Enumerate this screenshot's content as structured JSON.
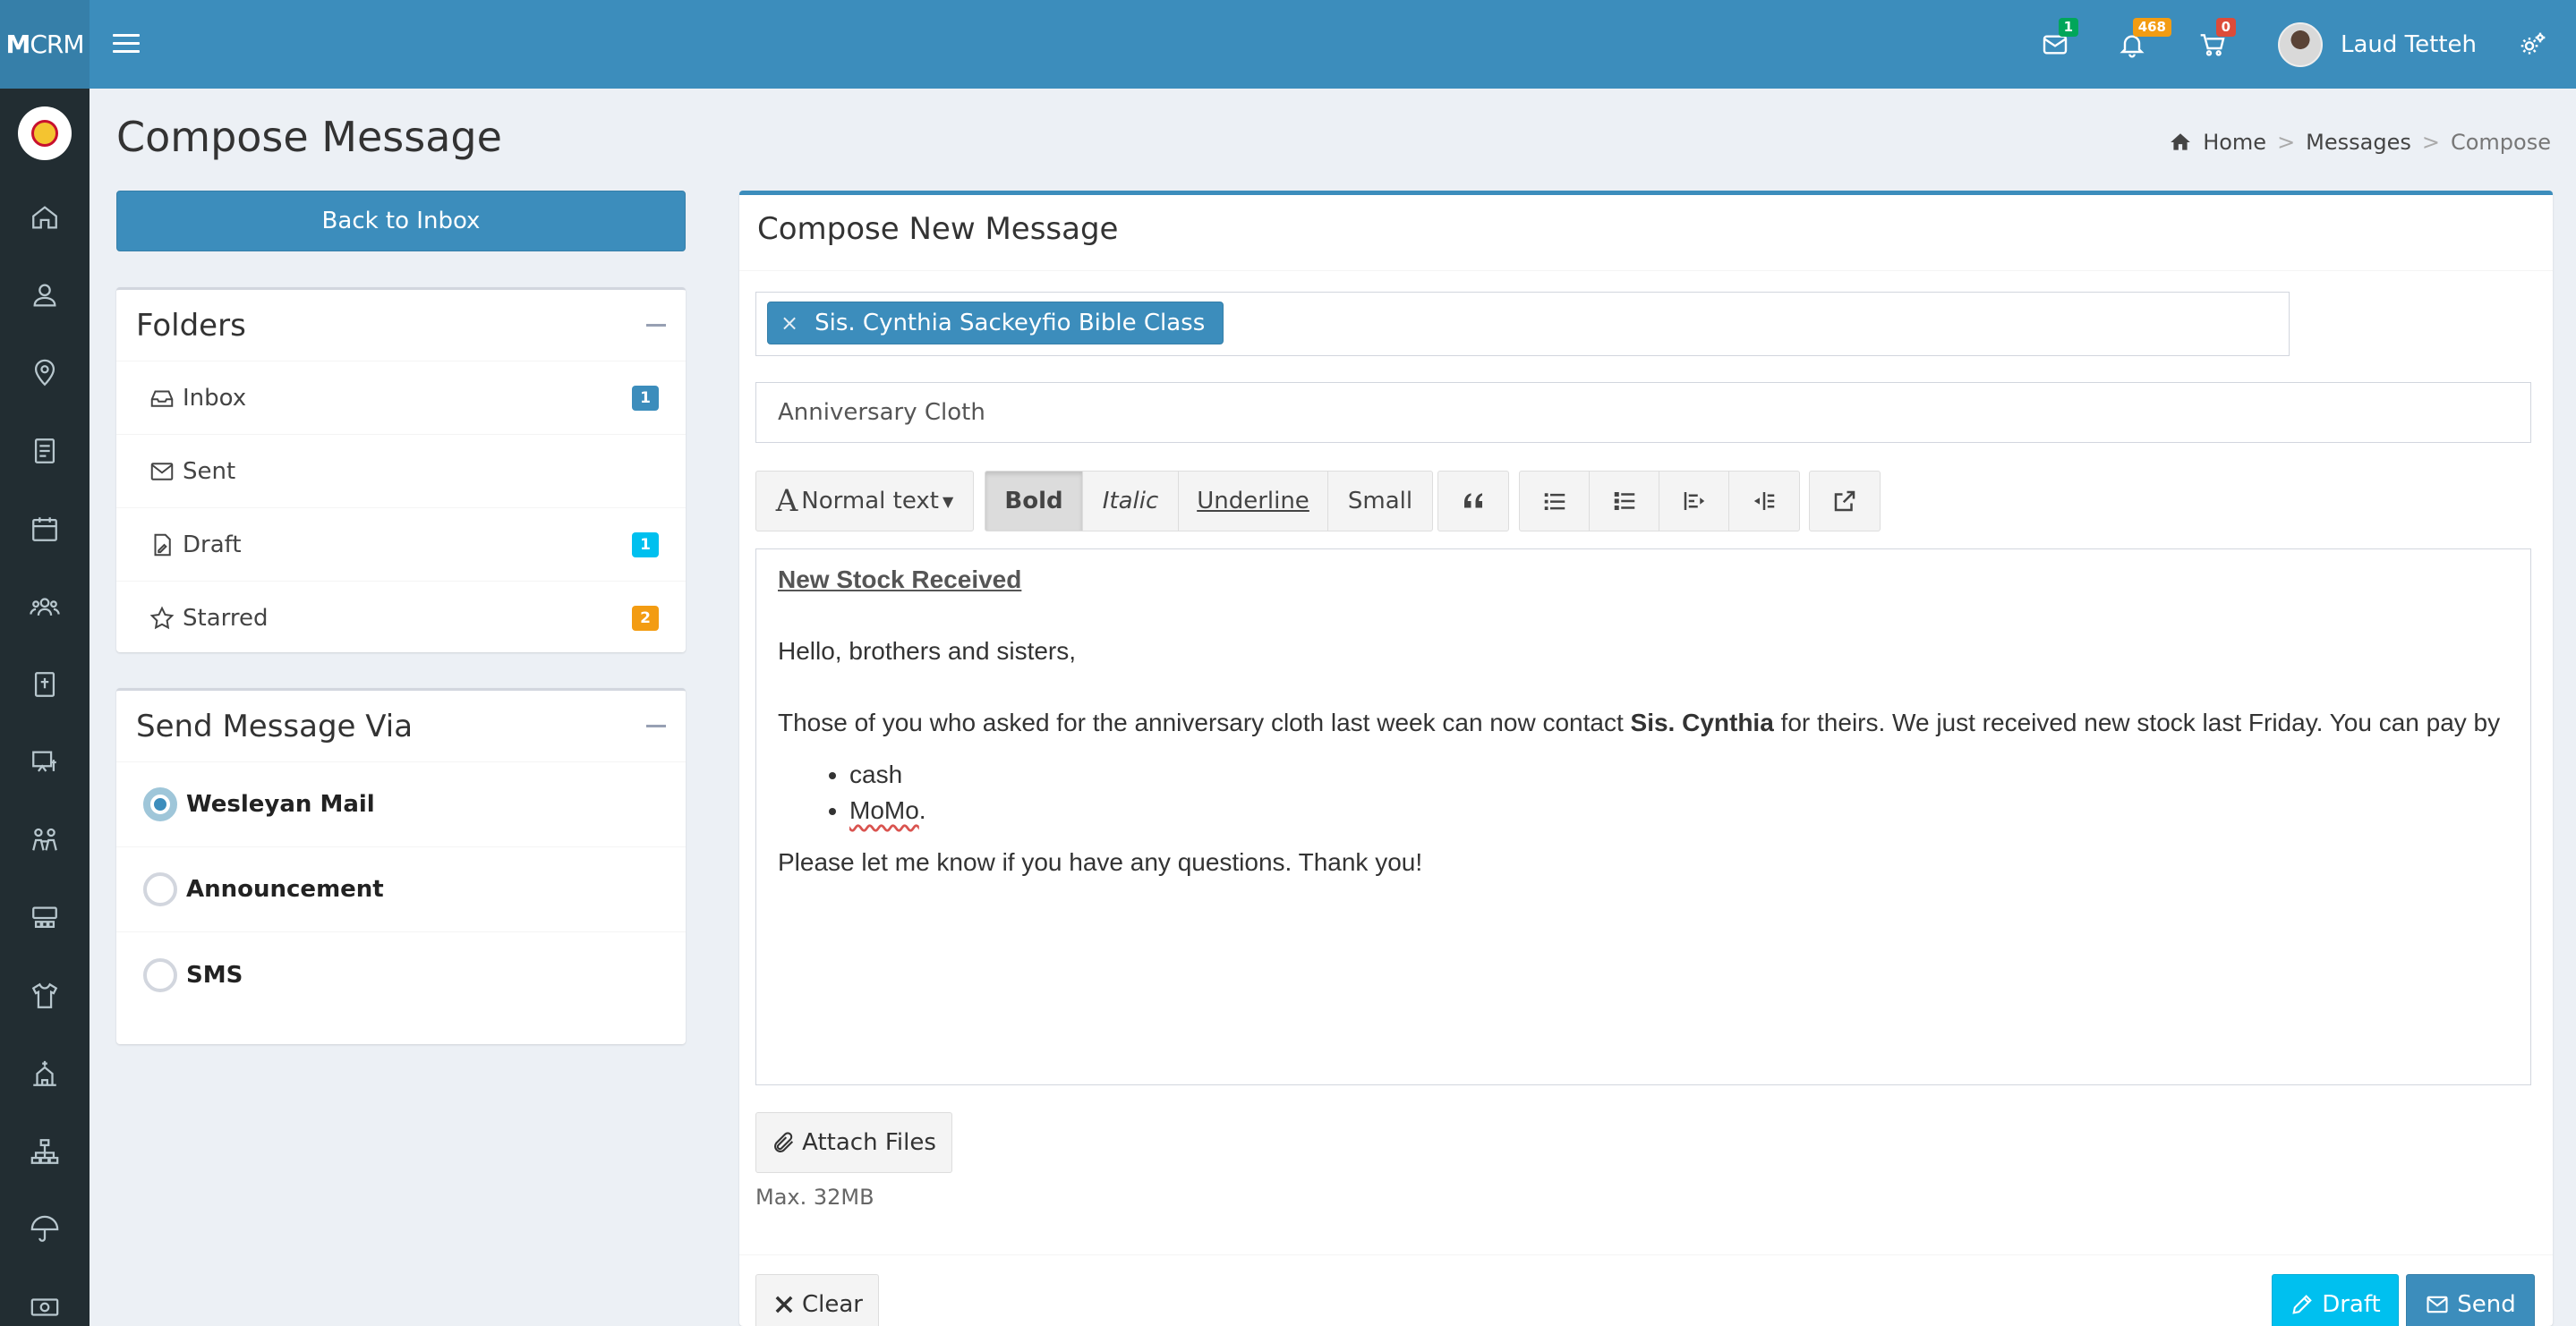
{
  "app": {
    "logo_bold": "M",
    "logo_rest": "CRM",
    "user_name": "Laud Tetteh",
    "notifications": {
      "mail_count": "1",
      "bell_count": "468",
      "cart_count": "0"
    }
  },
  "colors": {
    "primary": "#3c8dbc",
    "sidebar": "#222d32",
    "info": "#00c0ef",
    "warning": "#f39c12",
    "success": "#00a65a",
    "danger": "#dd4b39"
  },
  "sidebar_icons": [
    "home-icon",
    "user-icon",
    "map-pin-icon",
    "book-icon",
    "calendar-icon",
    "group-icon",
    "bible-icon",
    "presentation-icon",
    "people-icon",
    "seats-icon",
    "shirt-icon",
    "church-icon",
    "sitemap-icon",
    "umbrella-icon",
    "money-icon"
  ],
  "header": {
    "title": "Compose Message",
    "breadcrumb": {
      "home": "Home",
      "messages": "Messages",
      "current": "Compose"
    },
    "sep": ">"
  },
  "left": {
    "back_button": "Back to Inbox",
    "folders_title": "Folders",
    "folders": [
      {
        "label": "Inbox",
        "count": "1",
        "color": "#3c8dbc",
        "icon": "inbox-icon"
      },
      {
        "label": "Sent",
        "count": "",
        "icon": "envelope-icon"
      },
      {
        "label": "Draft",
        "count": "1",
        "color": "#00c0ef",
        "icon": "file-icon"
      },
      {
        "label": "Starred",
        "count": "2",
        "color": "#f39c12",
        "icon": "star-icon"
      }
    ],
    "send_via_title": "Send Message Via",
    "send_via": [
      {
        "label": "Wesleyan Mail",
        "checked": true
      },
      {
        "label": "Announcement",
        "checked": false
      },
      {
        "label": "SMS",
        "checked": false
      }
    ]
  },
  "compose": {
    "title": "Compose New Message",
    "recipient_tag": "Sis. Cynthia Sackeyfio Bible Class",
    "tag_remove": "×",
    "subject": "Anniversary Cloth",
    "toolbar": {
      "text_style": "Normal text",
      "bold": "Bold",
      "italic": "Italic",
      "underline": "Underline",
      "small": "Small"
    },
    "body": {
      "headline": "New Stock Received",
      "greeting": "Hello, brothers and sisters,",
      "para_before": "Those of you who asked for the anniversary cloth last week can now contact ",
      "para_bold": "Sis. Cynthia",
      "para_after": " for theirs. We just received new stock last Friday. You can pay by",
      "list": [
        "cash",
        "MoMo"
      ],
      "list_trailing": ".",
      "closing": "Please let me know if you have any questions. Thank you!"
    },
    "attach_label": "Attach Files",
    "max_size": "Max. 32MB",
    "clear_label": "Clear",
    "draft_label": "Draft",
    "send_label": "Send"
  }
}
